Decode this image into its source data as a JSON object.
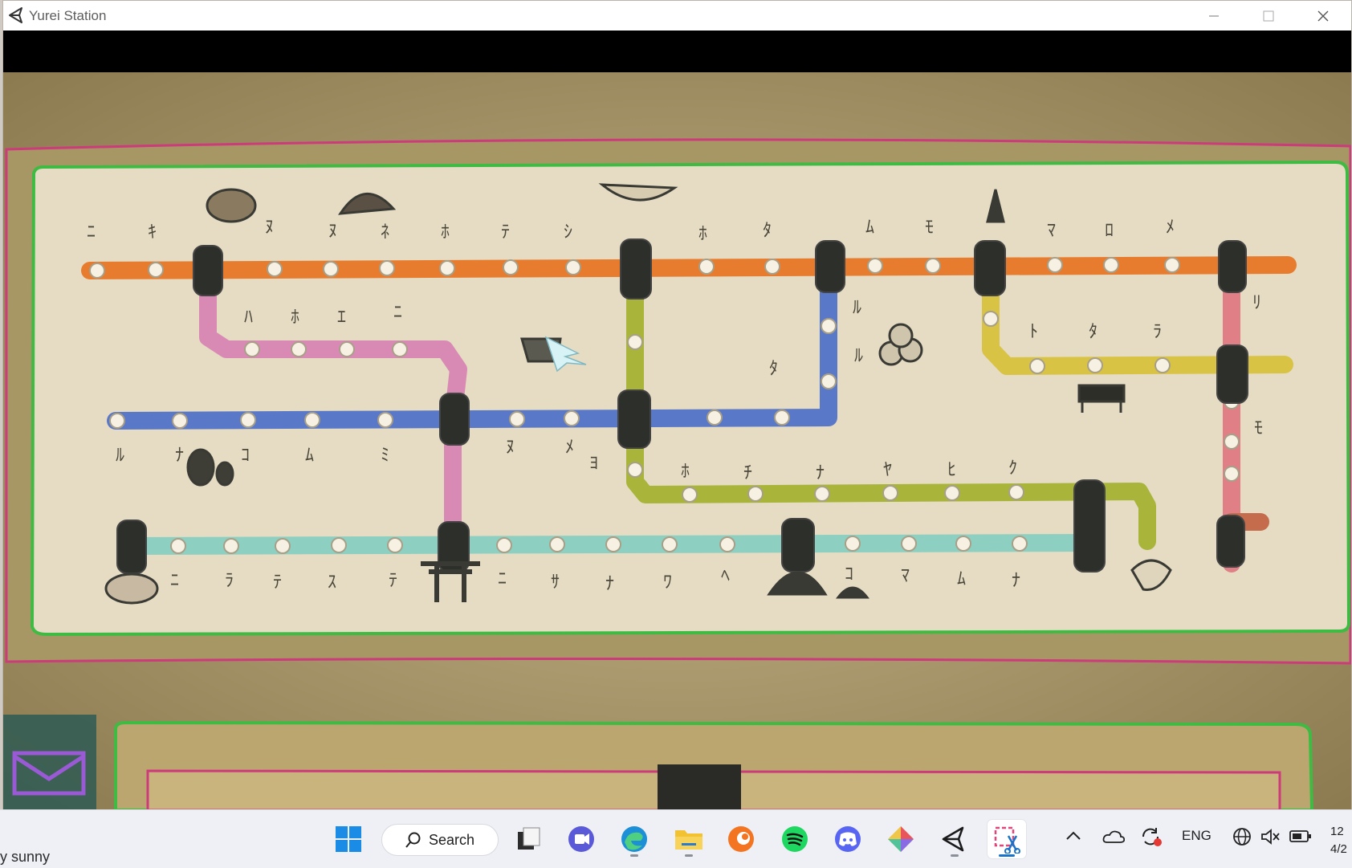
{
  "window": {
    "title": "Yurei Station"
  },
  "taskbar": {
    "weather": "y sunny",
    "search_label": "Search",
    "language": "ENG",
    "clock_time": "12",
    "clock_date": "4/2"
  },
  "icons": [
    "start-icon",
    "search-icon",
    "task-view-icon",
    "meet-icon",
    "edge-icon",
    "file-explorer-icon",
    "crunchyroll-icon",
    "spotify-icon",
    "discord-icon",
    "gitkraken-icon",
    "unity-icon",
    "snipping-tool-icon",
    "chevron-up-icon",
    "onedrive-icon",
    "sync-icon",
    "globe-icon",
    "mute-icon",
    "battery-icon",
    "mail-icon",
    "cursor-icon"
  ],
  "colors": {
    "orange_line": "#e77b2e",
    "pink_line": "#d98ab4",
    "blue_line": "#5a78c8",
    "olive_line": "#a8b53a",
    "yellow_line": "#d8c345",
    "teal_line": "#8dcfc0",
    "red_line": "#e07f86",
    "paper": "#e9dfc8",
    "station_hub": "#2c2f2a"
  }
}
